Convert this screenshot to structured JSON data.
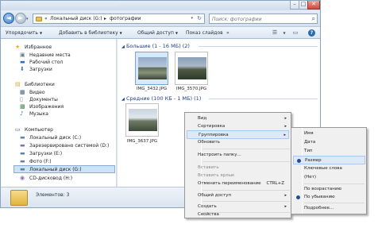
{
  "window": {
    "close_glyph": "✕",
    "min_glyph": "–",
    "max_glyph": "□"
  },
  "nav": {
    "back_glyph": "◄",
    "forward_glyph": "►",
    "dropdown_glyph": "▾"
  },
  "address": {
    "prefix": "«",
    "crumbs": [
      "Локальный диск (G:)",
      "фотографии"
    ],
    "separator": "▸",
    "refresh_glyph": "↻"
  },
  "search": {
    "placeholder": "Поиск: фотографии",
    "icon": "search-icon"
  },
  "toolbar": {
    "organize": "Упорядочить",
    "add_library": "Добавить в библиотеку",
    "share": "Общий доступ",
    "slideshow": "Показ слайдов",
    "more": "»"
  },
  "sidebar": {
    "favorites": "Избранное",
    "fav_items": [
      "Недавние места",
      "Рабочий стол",
      "Загрузки"
    ],
    "libraries": "Библиотеки",
    "lib_items": [
      "Видео",
      "Документы",
      "Изображения",
      "Музыка"
    ],
    "computer": "Компьютер",
    "comp_items": [
      "Локальный диск (C:)",
      "Зарезервировано системой (D:)",
      "Загрузки (E:)",
      "Фото (F:)",
      "Локальный диск (G:)",
      "CD-дисковод (H:)"
    ]
  },
  "content": {
    "group_large": "Большие (1 - 16 МБ) (2)",
    "group_medium": "Средние (100 КБ - 1 МБ) (1)",
    "files_large": [
      "IMG_3432.JPG",
      "IMG_3570.JPG"
    ],
    "files_medium": [
      "IMG_3637.JPG"
    ]
  },
  "status": {
    "text": "Элементов: 3"
  },
  "context_menu": {
    "view": "Вид",
    "sort": "Сортировка",
    "group": "Группировка",
    "refresh": "Обновить",
    "customize": "Настроить папку...",
    "paste": "Вставить",
    "paste_shortcut": "Вставить ярлык",
    "undo_rename": "Отменить переименование",
    "undo_shortcut": "CTRL+Z",
    "share": "Общий доступ",
    "create": "Создать",
    "properties": "Свойства",
    "arrow": "▸"
  },
  "group_menu": {
    "name": "Имя",
    "date": "Дата",
    "type": "Тип",
    "size": "Размер",
    "tags": "Ключевые слова",
    "none": "(Нет)",
    "asc": "По возрастанию",
    "desc": "По убыванию",
    "more": "Подробнее..."
  }
}
